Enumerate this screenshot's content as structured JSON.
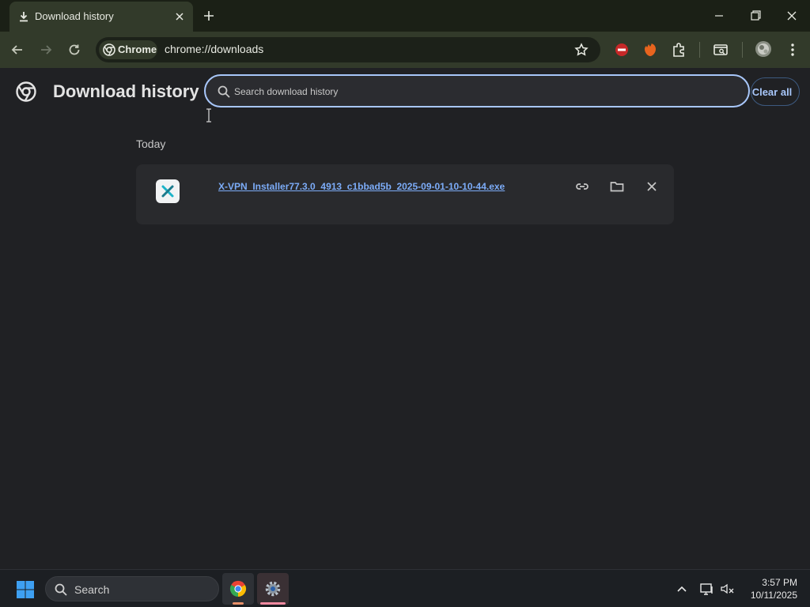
{
  "tab": {
    "title": "Download history",
    "favicon": "download-icon"
  },
  "window_controls": [
    "minimize-icon",
    "restore-icon",
    "close-icon"
  ],
  "toolbar": {
    "chip_label": "Chrome",
    "url": "chrome://downloads",
    "icons": [
      "back-arrow-icon",
      "forward-arrow-icon",
      "reload-icon",
      "bookmark-star-icon",
      "adblock-extension-icon",
      "brave-lion-extension-icon",
      "extensions-puzzle-icon",
      "tab-search-icon",
      "profile-avatar",
      "menu-kebab-icon"
    ]
  },
  "page": {
    "title": "Download history",
    "search_placeholder": "Search download history",
    "clear_all_label": "Clear all"
  },
  "downloads": {
    "section": "Today",
    "items": [
      {
        "file_name": "X-VPN_Installer77.3.0_4913_c1bbad5b_2025-09-01-10-10-44.exe",
        "icon": "x-vpn-app-icon",
        "actions": [
          "copy-link-icon",
          "show-in-folder-icon",
          "remove-icon"
        ]
      }
    ]
  },
  "taskbar": {
    "search_label": "Search",
    "apps": [
      "chrome-app-icon",
      "settings-app-icon"
    ],
    "tray": [
      "show-hidden-icons-chevron",
      "display-icon",
      "network-sound-icon"
    ],
    "time": "3:57 PM",
    "date": "10/11/2025"
  },
  "colors": {
    "accent": "#a8c7fa",
    "link": "#7cacf8",
    "page_background": "#202124",
    "toolbar": "#323a2a"
  }
}
